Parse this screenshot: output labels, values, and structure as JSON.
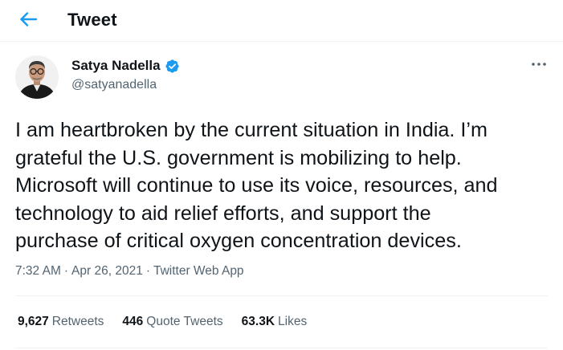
{
  "header": {
    "title": "Tweet",
    "back_icon": "arrow-left-icon",
    "accent_color": "#1d9bf0"
  },
  "author": {
    "name": "Satya Nadella",
    "handle": "@satyanadella",
    "verified": true,
    "verified_icon": "verified-badge-icon",
    "verified_color": "#1d9bf0"
  },
  "more_icon": "more-horizontal-icon",
  "tweet": {
    "lines": [
      "I am heartbroken by the current situation in India. I’m",
      "grateful the U.S. government is mobilizing to help.",
      "Microsoft will continue to use its voice, resources, and",
      "technology to aid relief efforts, and support the",
      "purchase of critical oxygen concentration devices."
    ]
  },
  "meta": {
    "time": "7:32 AM",
    "separator": "·",
    "date": "Apr 26, 2021",
    "source": "Twitter Web App"
  },
  "stats": {
    "retweets": {
      "count": "9,627",
      "label": "Retweets"
    },
    "quotes": {
      "count": "446",
      "label": "Quote Tweets"
    },
    "likes": {
      "count": "63.3K",
      "label": "Likes"
    }
  }
}
